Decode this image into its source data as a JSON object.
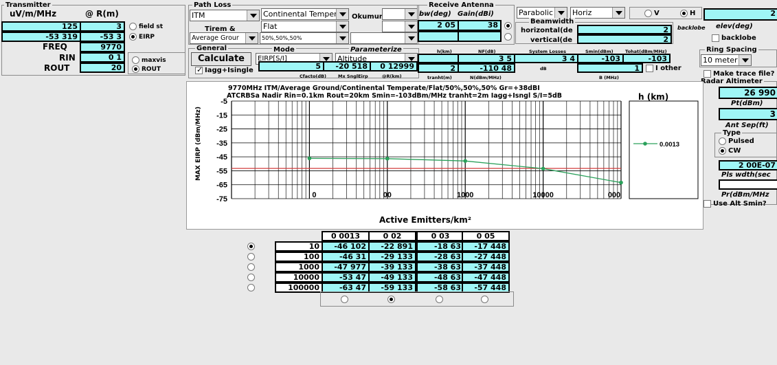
{
  "transmitter": {
    "group_title": "Transmitter",
    "col1_header": "uV/m/MHz",
    "col2_header": "@ R(m)",
    "uvm_value": "125",
    "r_value": "3",
    "field_label": "field st",
    "eirp_value1": "-53 319",
    "eirp_value2": "-53 3",
    "eirp_label": "EIRP",
    "freq_label": "FREQ",
    "freq_value": "9770",
    "rin_label": "RIN",
    "rin_value": "0 1",
    "rout_label": "ROUT",
    "rout_value": "20",
    "maxvis_label": "maxvis",
    "rout_radio_label": "ROUT"
  },
  "path_loss": {
    "group_title": "Path Loss",
    "model": "ITM",
    "climate": "Continental Temper",
    "okumura_label": "Okumura",
    "terrain": "Flat",
    "tirem_label": "Tirem &",
    "ground": "Average Grour",
    "pct": "50%,50%,50%"
  },
  "general": {
    "group_title": "General",
    "calculate": "Calculate",
    "mode_title": "Mode",
    "mode_value": "EIRP[S/I]",
    "param_title": "Parameterize",
    "param_value": "Altitude",
    "iagg_label": "Iagg+Isingle",
    "val5": "5",
    "val_neg20": "-20 518",
    "val_012999": "0 12999",
    "lbl_cfactor": "Cfacto(dB)",
    "lbl_mxsngl": "Mx SnglEirp",
    "lbl_rkm": "@R(km)"
  },
  "receive": {
    "group_title": "Receive Antenna",
    "bw_label": "bw(deg)",
    "gain_label": "Gain(dBi)",
    "bw_value": "2 05",
    "gain_value": "38",
    "type": "Parabolic",
    "orient": "Horiz",
    "beamwidth_label": "Beamwidth",
    "horiz_label": "horizontal(de",
    "vert_label": "vertical(de",
    "horiz_value": "2",
    "vert_value": "2",
    "pol_v": "V",
    "pol_h": "H",
    "right_value": "2",
    "backlobe_label": "backlobe",
    "elev_label": "elev(deg)",
    "backlobe_check_label": "backlobe"
  },
  "row3": {
    "h_label": "h(km)",
    "nf_label": "NF(dB)",
    "sysloss_label": "System Losses",
    "smin_label": "Smin(dBm)",
    "tohat_label": "Tohat(dBm/MHz)",
    "nf_value": "3 5",
    "sysloss_value": "3 4",
    "smin_value": "-103",
    "tohat_value": "-103",
    "tranht_value": "2",
    "n_value": "-110 48",
    "db_label": "dB",
    "b_value": "1",
    "tranht_label": "tranht(m)",
    "n_label": "N(dBm/MHz)",
    "b_label": "B (MHz)",
    "iother_label": "I other"
  },
  "ring": {
    "title": "Ring Spacing",
    "value": "10 meter",
    "trace_label": "Make trace file?"
  },
  "radar": {
    "title": "Radar Altimeter",
    "value1": "26 990",
    "pt_label": "Pt(dBm)",
    "value2": "3",
    "antsep_label": "Ant Sep(ft)",
    "type_title": "Type",
    "pulsed": "Pulsed",
    "cw": "CW",
    "value3": "2 00E-07",
    "pls_label": "Pls wdth(sec",
    "pr_label": "Pr(dBm/MHz",
    "use_alt": "Use Alt Smin?"
  },
  "chart_data": {
    "type": "line",
    "title": "9770MHz ITM/Average Ground/Continental Temperate/Flat/50%,50%,50% Gr=+38dBI",
    "subtitle": "ATCRBSa Nadir Rin=0.1km Rout=20km Smin=-103dBm/MHz  tranht=2m Iagg+Isngl S/I=5dB",
    "xlabel": "Active Emitters/km²",
    "ylabel": "MAX EIRP (dBm/MHz)",
    "xscale": "log",
    "xlim": [
      1,
      100000
    ],
    "ylim": [
      -75,
      -5
    ],
    "yticks": [
      "-5",
      "-15",
      "-25",
      "-35",
      "-45",
      "-55",
      "-65",
      "-75"
    ],
    "xticks": [
      "0",
      "00",
      "1000",
      "10000",
      "000"
    ],
    "legend_title": "h (km)",
    "series": [
      {
        "name": "0.0013",
        "color": "#2aa05a",
        "x": [
          10,
          100,
          1000,
          10000,
          100000
        ],
        "y": [
          -46.102,
          -46.31,
          -47.977,
          -53.47,
          -63.47
        ]
      }
    ],
    "threshold": {
      "y": -53.3,
      "color": "#d03a3a"
    }
  },
  "table": {
    "headers": [
      "0 0013",
      "0 02",
      "0 03",
      "0 05"
    ],
    "rows": [
      {
        "x": "10",
        "v": [
          "-46 102",
          "-22 891",
          "-18 63",
          "-17 448"
        ]
      },
      {
        "x": "100",
        "v": [
          "-46 31",
          "-29 133",
          "-28 63",
          "-27 448"
        ]
      },
      {
        "x": "1000",
        "v": [
          "-47 977",
          "-39 133",
          "-38 63",
          "-37 448"
        ]
      },
      {
        "x": "10000",
        "v": [
          "-53 47",
          "-49 133",
          "-48 63",
          "-47 448"
        ]
      },
      {
        "x": "100000",
        "v": [
          "-63 47",
          "-59 133",
          "-58 63",
          "-57 448"
        ]
      }
    ]
  }
}
